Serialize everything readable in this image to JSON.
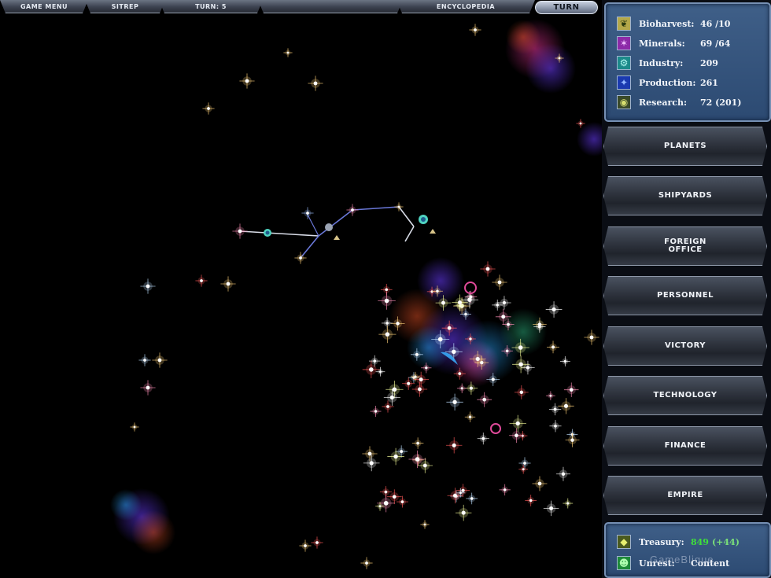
{
  "topbar": {
    "game_menu": "GAME MENU",
    "sitrep": "SITREP",
    "turn_counter": "TURN: 5",
    "encyclopedia": "ENCYCLOPEDIA",
    "turn_button": "TURN"
  },
  "resources": {
    "biharvest": {
      "label": "Bioharvest:",
      "value": "46 /10"
    },
    "minerals": {
      "label": "Minerals:",
      "value": "69 /64"
    },
    "industry": {
      "label": "Industry:",
      "value": "209"
    },
    "production": {
      "label": "Production:",
      "value": "261"
    },
    "research": {
      "label": "Research:",
      "value": "72 (201)"
    }
  },
  "nav": {
    "planets": "PLANETS",
    "shipyards": "SHIPYARDS",
    "foreign_office_1": "FOREIGN",
    "foreign_office_2": "OFFICE",
    "personnel": "PERSONNEL",
    "victory": "VICTORY",
    "technology": "TECHNOLOGY",
    "finance": "FINANCE",
    "empire": "EMPIRE"
  },
  "status": {
    "treasury_label": "Treasury:",
    "treasury_value": "849",
    "treasury_delta": "(+44)",
    "unrest_label": "Unrest:",
    "unrest_value": "Content"
  },
  "watermark": "GameBlique",
  "colors": {
    "panel_blue": "#3f5f88",
    "positive_green": "#3fe03a",
    "route_line": "#d9dde8"
  }
}
